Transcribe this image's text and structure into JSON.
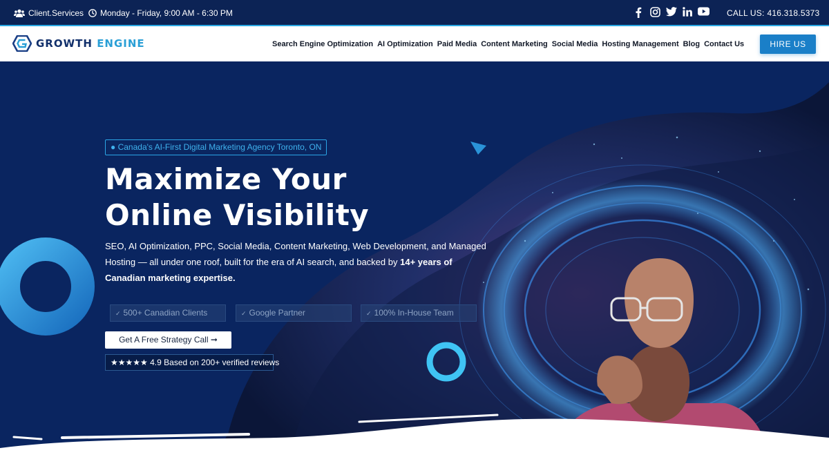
{
  "topbar": {
    "client_services": "Client.Services",
    "hours": "Monday - Friday, 9:00 AM - 6:30 PM",
    "call_label": "CALL US:",
    "phone": "416.318.5373",
    "social_icons": [
      "facebook-icon",
      "instagram-icon",
      "twitter-icon",
      "linkedin-icon",
      "youtube-icon"
    ]
  },
  "brand": {
    "name_part1": "GROWTH",
    "name_part2": "ENGINE"
  },
  "nav": {
    "items": [
      "Search Engine Optimization",
      "AI Optimization",
      "Paid Media",
      "Content Marketing",
      "Social Media",
      "Hosting Management",
      "Blog",
      "Contact Us"
    ],
    "hire_label": "HIRE US"
  },
  "hero": {
    "badge": "● Canada's AI-First Digital Marketing Agency Toronto, ON",
    "headline_line1": "Maximize Your",
    "headline_line2": "Online Visibility",
    "description_main": "SEO, AI Optimization, PPC, Social Media, Content Marketing, Web Development, and Managed Hosting — all under one roof, built for the era of AI search, and backed by",
    "description_bold": "14+ years of Canadian marketing expertise.",
    "pills": [
      "500+ Canadian Clients",
      "Google Partner",
      "100% In-House Team"
    ],
    "cta_label": "Get A Free Strategy Call",
    "cta_arrow": "➞",
    "reviews": "★★★★★ 4.9 Based on 200+ verified reviews"
  },
  "colors": {
    "topbar_bg": "#0c2355",
    "hero_bg": "#0a2560",
    "accent": "#2aa8e4",
    "button": "#1a7fc8"
  }
}
